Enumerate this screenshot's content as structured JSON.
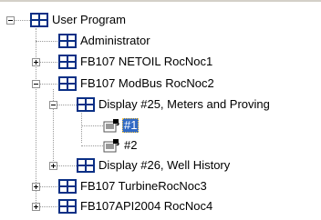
{
  "tree": {
    "root_label": "User Program",
    "items": [
      {
        "label": "Administrator",
        "icon": "module-grid-icon"
      },
      {
        "label": "FB107 NETOIL RocNoc1",
        "icon": "module-grid-icon",
        "expander": "+"
      },
      {
        "label": "FB107 ModBus RocNoc2",
        "icon": "module-grid-icon",
        "expander": "-"
      },
      {
        "label": "Display #25, Meters and Proving",
        "icon": "module-grid-icon",
        "expander": "-"
      },
      {
        "label": "#1",
        "icon": "display-page-icon",
        "selected": true
      },
      {
        "label": "#2",
        "icon": "display-page-icon"
      },
      {
        "label": "Display #26, Well History",
        "icon": "module-grid-icon",
        "expander": "+"
      },
      {
        "label": "FB107 TurbineRocNoc3",
        "icon": "module-grid-icon",
        "expander": "+"
      },
      {
        "label": "FB107API2004 RocNoc4",
        "icon": "module-grid-icon",
        "expander": "+"
      }
    ]
  },
  "colors": {
    "selection": "#316ac5",
    "icon_grid": "#0a2f85",
    "icon_fill": "#ffffff",
    "tree_lines": "#9a9a9a"
  }
}
